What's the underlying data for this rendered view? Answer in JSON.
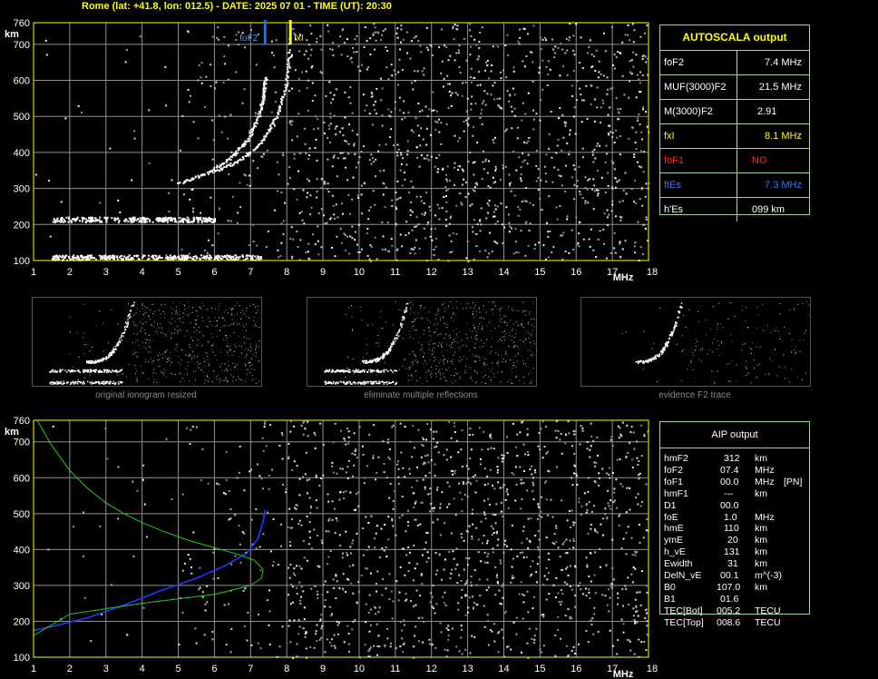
{
  "header": "Rome (lat: +41.8, lon: 012.5) - DATE: 2025 07 01 - TIME (UT): 20:30",
  "colors": {
    "frame": "#ffff00",
    "grid": "#909090",
    "axis_text": "#ffffff",
    "fof2_marker": "#1e6fff",
    "fxi_marker": "#ffff00",
    "profile_blue": "#1e3cff",
    "profile_green": "#22cc22",
    "panel_border": "#9fd99f"
  },
  "chart_data": [
    {
      "type": "scatter",
      "title": "",
      "xlabel": "MHz",
      "ylabel": "km",
      "xlim": [
        1,
        18
      ],
      "ylim": [
        100,
        760
      ],
      "x_ticks": [
        "1",
        "2",
        "3",
        "4",
        "5",
        "6",
        "7",
        "8",
        "9",
        "10",
        "11",
        "12",
        "13",
        "14",
        "15",
        "16",
        "17",
        "18"
      ],
      "y_ticks": [
        "100",
        "200",
        "300",
        "400",
        "500",
        "600",
        "700",
        "760"
      ],
      "grid": true,
      "markers": [
        {
          "label": "foF2",
          "x": 7.4,
          "color": "#1e6fff"
        },
        {
          "label": "fxI",
          "x": 8.1,
          "color": "#ffff00"
        }
      ],
      "traces": [
        {
          "name": "E",
          "x_range": [
            1.5,
            7.3
          ],
          "h": 110
        },
        {
          "name": "Es",
          "x_range": [
            1.5,
            6.0
          ],
          "h": 215
        },
        {
          "name": "F2 o-trace",
          "x": [
            5.0,
            5.8,
            6.4,
            6.9,
            7.2,
            7.35,
            7.4
          ],
          "h": [
            315,
            345,
            385,
            435,
            500,
            560,
            610
          ]
        },
        {
          "name": "F2 x-trace",
          "x": [
            6.0,
            6.7,
            7.3,
            7.7,
            7.95,
            8.1
          ],
          "h": [
            350,
            380,
            430,
            500,
            580,
            690
          ]
        }
      ]
    },
    {
      "type": "scatter",
      "title": "",
      "xlabel": "MHz",
      "ylabel": "km",
      "xlim": [
        1,
        18
      ],
      "ylim": [
        100,
        760
      ],
      "x_ticks": [
        "1",
        "2",
        "3",
        "4",
        "5",
        "6",
        "7",
        "8",
        "9",
        "10",
        "11",
        "12",
        "13",
        "14",
        "15",
        "16",
        "17",
        "18"
      ],
      "y_ticks": [
        "100",
        "200",
        "300",
        "400",
        "500",
        "600",
        "700",
        "760"
      ],
      "grid": true,
      "series": [
        {
          "type": "line",
          "color": "#1e3cff",
          "x": [
            1.0,
            1.5,
            2.5,
            3.5,
            4.5,
            5.5,
            6.3,
            6.9,
            7.2,
            7.35,
            7.4
          ],
          "h": [
            175,
            185,
            210,
            245,
            285,
            320,
            355,
            390,
            430,
            480,
            510
          ]
        },
        {
          "type": "line",
          "color": "#22cc22",
          "x": [
            1.1,
            1.5,
            2.0,
            2.5,
            3.0,
            3.5,
            4.0,
            4.6,
            5.3,
            6.0,
            6.7,
            7.1,
            7.35,
            7.3,
            7.0,
            6.0,
            4.0,
            2.0,
            1.0
          ],
          "h": [
            760,
            690,
            620,
            570,
            530,
            500,
            475,
            450,
            425,
            405,
            385,
            370,
            345,
            320,
            300,
            275,
            250,
            220,
            160
          ]
        }
      ]
    }
  ],
  "autoscala": {
    "title": "AUTOSCALA output",
    "rows": [
      {
        "label": "foF2",
        "value": "7.4 MHz",
        "color": "#ffffff"
      },
      {
        "label": "MUF(3000)F2",
        "value": "21.5 MHz",
        "color": "#ffffff"
      },
      {
        "label": "M(3000)F2",
        "value": "2.91",
        "color": "#ffffff"
      },
      {
        "label": "fxI",
        "value": "8.1 MHz",
        "color": "#ffff00"
      },
      {
        "label": "foF1",
        "value": "NO",
        "color": "#ff2a2a"
      },
      {
        "label": "ftEs",
        "value": "7.3 MHz",
        "color": "#2f7bff"
      },
      {
        "label": "h'Es",
        "value": "099    km",
        "color": "#ffffff"
      }
    ]
  },
  "thumbnails": [
    {
      "caption": "original ionogram resized"
    },
    {
      "caption": "eliminate multiple reflections"
    },
    {
      "caption": "evidence F2 trace"
    }
  ],
  "aip": {
    "title": "AIP output",
    "rows": [
      {
        "name": "hmF2",
        "value": "312",
        "unit": "km",
        "note": ""
      },
      {
        "name": "foF2",
        "value": "07.4",
        "unit": "MHz",
        "note": ""
      },
      {
        "name": "foF1",
        "value": "00.0",
        "unit": "MHz",
        "note": "[PN]"
      },
      {
        "name": "hmF1",
        "value": "---",
        "unit": "km",
        "note": ""
      },
      {
        "name": "D1",
        "value": "00.0",
        "unit": "",
        "note": ""
      },
      {
        "name": "foE",
        "value": "1.0",
        "unit": "MHz",
        "note": ""
      },
      {
        "name": "hmE",
        "value": "110",
        "unit": "km",
        "note": ""
      },
      {
        "name": "ymE",
        "value": "20",
        "unit": "km",
        "note": ""
      },
      {
        "name": "h_vE",
        "value": "131",
        "unit": "km",
        "note": ""
      },
      {
        "name": "Ewidth",
        "value": "31",
        "unit": "km",
        "note": ""
      },
      {
        "name": "DelN_vE",
        "value": "00.1",
        "unit": "m^(-3)",
        "note": ""
      },
      {
        "name": "B0",
        "value": "107.0",
        "unit": "km",
        "note": ""
      },
      {
        "name": "B1",
        "value": "01.6",
        "unit": "",
        "note": ""
      },
      {
        "name": "TEC[Bot]",
        "value": "005.2",
        "unit": "TECU",
        "note": ""
      },
      {
        "name": "TEC[Top]",
        "value": "008.6",
        "unit": "TECU",
        "note": ""
      }
    ]
  }
}
